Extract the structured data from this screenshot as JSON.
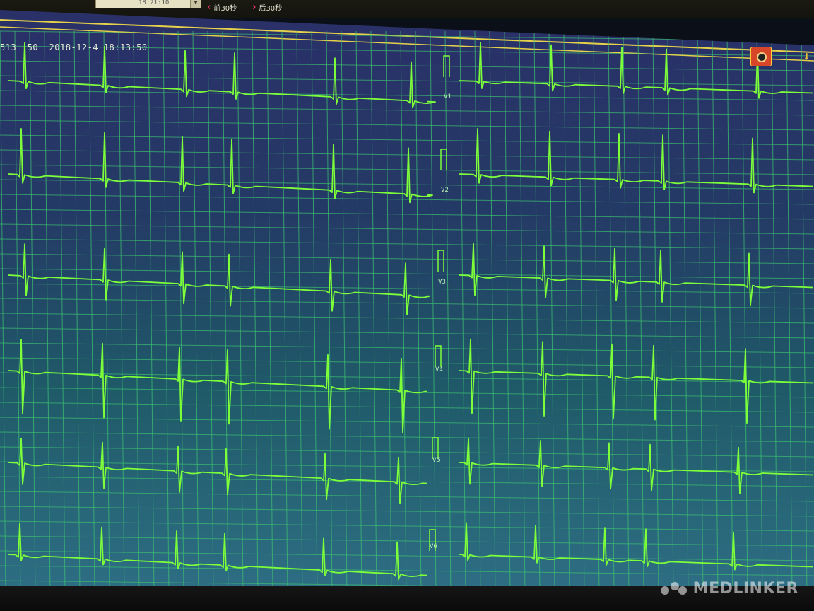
{
  "toolbar": {
    "time_select_value": "18:21:10",
    "prev_label": "前30秒",
    "next_label": "后30秒"
  },
  "header": {
    "record_id": "513",
    "heart_rate": "50",
    "timestamp": "2018-12-4 18:13:50"
  },
  "leads": [
    {
      "label": "V1"
    },
    {
      "label": "V2"
    },
    {
      "label": "V3"
    },
    {
      "label": "V4"
    },
    {
      "label": "V5"
    },
    {
      "label": "V6"
    }
  ],
  "icons": {
    "snapshot": "camera-icon",
    "scroll": "down-arrow-icon",
    "prev": "chevron-left-icon",
    "next": "chevron-right-icon"
  },
  "colors": {
    "trace": "#7dff3a",
    "grid": "#3cc070",
    "screen_top": "#2a3068",
    "screen_bottom": "#2e6e84",
    "accent_line": "#e6d24a"
  },
  "watermark": {
    "text": "MEDLINKER"
  }
}
